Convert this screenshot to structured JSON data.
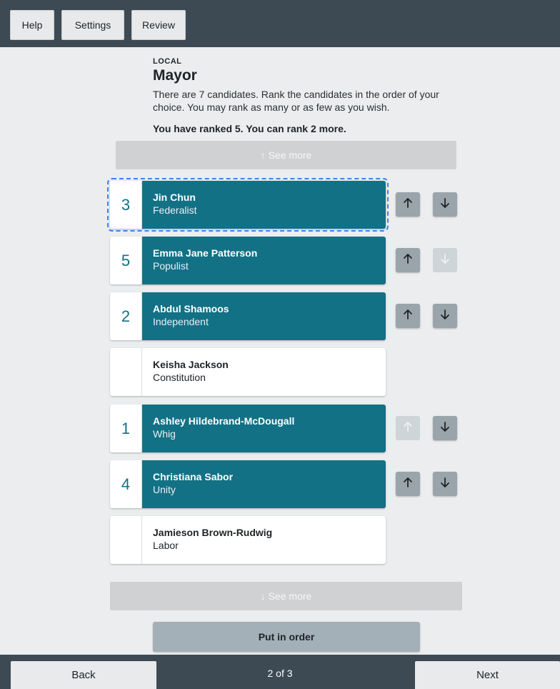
{
  "toolbar": {
    "help": "Help",
    "settings": "Settings",
    "review": "Review"
  },
  "contest": {
    "category": "LOCAL",
    "title": "Mayor",
    "instructions": "There are 7 candidates. Rank the candidates in the order of your choice. You may rank as many or as few as you wish.",
    "status": "You have ranked 5. You can rank 2 more."
  },
  "see_more_up": "↑ See more",
  "see_more_down": "↓ See more",
  "candidates": [
    {
      "rank": "3",
      "name": "Jin Chun",
      "party": "Federalist",
      "ranked": true,
      "up_enabled": true,
      "down_enabled": true
    },
    {
      "rank": "5",
      "name": "Emma Jane Patterson",
      "party": "Populist",
      "ranked": true,
      "up_enabled": true,
      "down_enabled": false
    },
    {
      "rank": "2",
      "name": "Abdul Shamoos",
      "party": "Independent",
      "ranked": true,
      "up_enabled": true,
      "down_enabled": true
    },
    {
      "rank": "",
      "name": "Keisha Jackson",
      "party": "Constitution",
      "ranked": false
    },
    {
      "rank": "1",
      "name": "Ashley Hildebrand-McDougall",
      "party": "Whig",
      "ranked": true,
      "up_enabled": false,
      "down_enabled": true
    },
    {
      "rank": "4",
      "name": "Christiana Sabor",
      "party": "Unity",
      "ranked": true,
      "up_enabled": true,
      "down_enabled": true
    },
    {
      "rank": "",
      "name": "Jamieson Brown-Rudwig",
      "party": "Labor",
      "ranked": false
    }
  ],
  "put_in_order": "Put in order",
  "footer": {
    "back": "Back",
    "page": "2 of 3",
    "next": "Next"
  },
  "colors": {
    "ranked": "#137185",
    "bar": "#3d4a54",
    "focus": "#3b82f6"
  },
  "icons": {
    "up": "arrow-up-icon",
    "down": "arrow-down-icon"
  }
}
